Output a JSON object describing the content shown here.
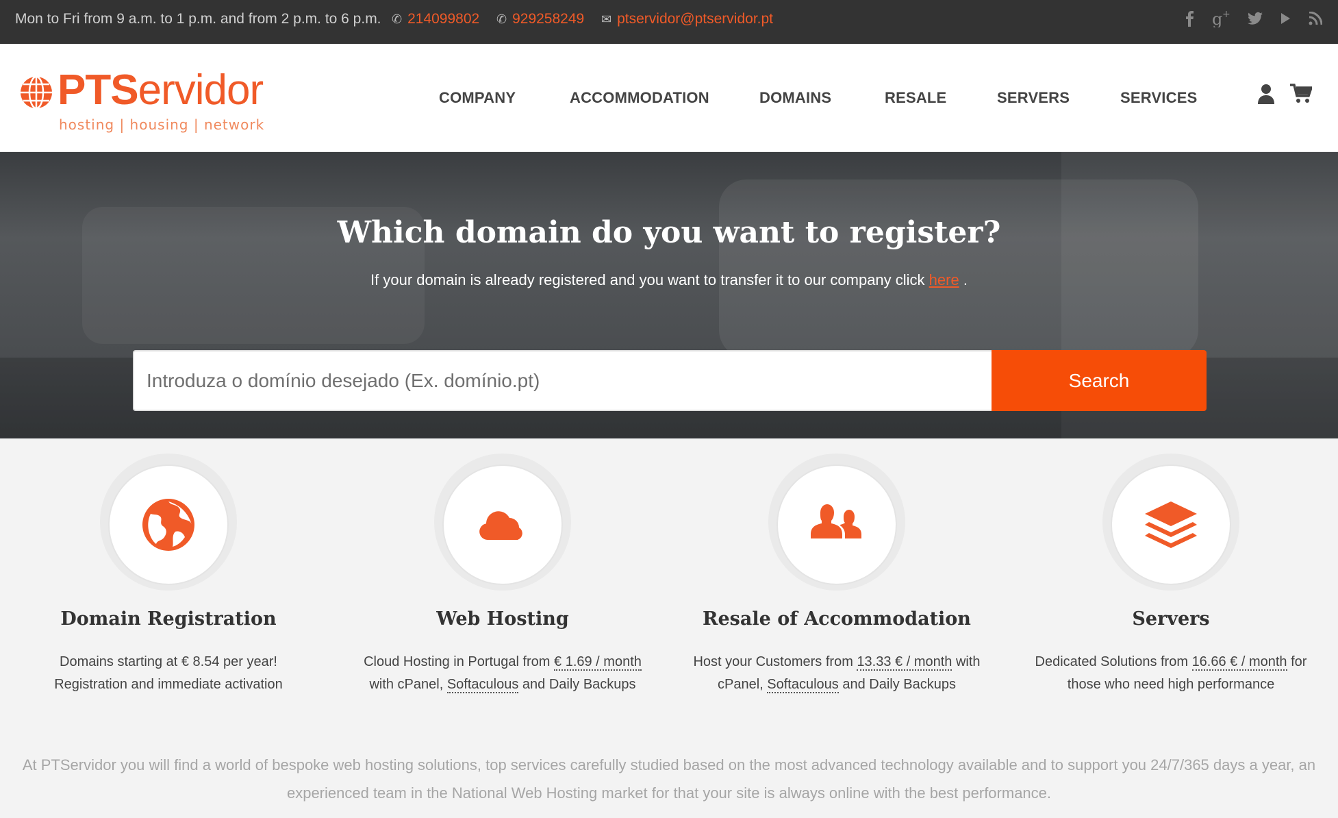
{
  "topbar": {
    "hours": "Mon to Fri from 9 a.m. to 1 p.m. and from 2 p.m. to 6 p.m.",
    "phone1": "214099802",
    "phone2": "929258249",
    "email": "ptservidor@ptservidor.pt",
    "social_icons": [
      "facebook-icon",
      "google-plus-icon",
      "twitter-icon",
      "youtube-icon",
      "rss-icon"
    ]
  },
  "header": {
    "logo_bold": "PTS",
    "logo_light": "ervidor",
    "logo_tagline": "hosting | housing | network",
    "nav": [
      "COMPANY",
      "ACCOMMODATION",
      "DOMAINS",
      "RESALE",
      "SERVERS",
      "SERVICES"
    ],
    "icons": [
      "user-icon",
      "cart-icon"
    ]
  },
  "hero": {
    "title": "Which domain do you want to register?",
    "subtitle_pre": "If your domain is already registered and you want to transfer it to our company click ",
    "subtitle_link": "here",
    "subtitle_post": " .",
    "search_placeholder": "Introduza o domínio desejado (Ex. domínio.pt)",
    "search_button": "Search"
  },
  "features": [
    {
      "icon": "globe-icon",
      "title": "Domain Registration",
      "line1": "Domains starting at € 8.54 per year!",
      "line2": "Registration and immediate activation"
    },
    {
      "icon": "cloud-icon",
      "title": "Web Hosting",
      "l1a": "Cloud Hosting in Portugal from ",
      "l1b": "€ 1.69 / month",
      "l2a": "with cPanel, ",
      "l2b": "Softaculous",
      "l2c": " and Daily Backups"
    },
    {
      "icon": "users-icon",
      "title": "Resale of Accommodation",
      "l1a": "Host your Customers from ",
      "l1b": "13.33 € / month",
      "l1c": " with",
      "l2a": "cPanel, ",
      "l2b": "Softaculous",
      "l2c": " and Daily Backups"
    },
    {
      "icon": "layers-icon",
      "title": "Servers",
      "l1a": "Dedicated Solutions from ",
      "l1b": "16.66 € / month",
      "l1c": " for",
      "l2a": "those who need high performance"
    }
  ],
  "intro": "At PTServidor you will find a world of bespoke web hosting solutions, top services carefully studied based on the most advanced technology available and to support you 24/7/365 days a year, an experienced team in the National Web Hosting market for that your site is always online with the best performance.",
  "colors": {
    "accent": "#f05a28",
    "button": "#f64d07",
    "topbar": "#333333"
  }
}
